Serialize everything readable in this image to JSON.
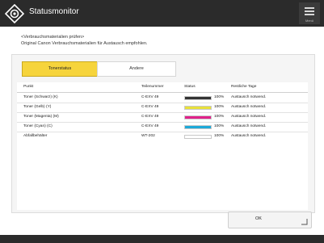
{
  "title_bar": {
    "app_title": "Statusmonitor",
    "menu_label": "Menü"
  },
  "message": {
    "line1": "<Verbrauchsmaterialien prüfen>",
    "line2": "Original Canon Verbrauchsmaterialien für Austausch empfohlen."
  },
  "tabs": [
    {
      "label": "Tonerstatus",
      "active": true
    },
    {
      "label": "Andere",
      "active": false
    }
  ],
  "table": {
    "headers": [
      "Punkt",
      "Teilenummer",
      "Status",
      "Restliche Tage"
    ],
    "rows": [
      {
        "item": "Toner (Schwarz) (K)",
        "part": "C-EXV 49",
        "level": "100%",
        "days": "Austausch notwend.",
        "color": "#333333"
      },
      {
        "item": "Toner (Gelb) (Y)",
        "part": "C-EXV 49",
        "level": "100%",
        "days": "Austausch notwend.",
        "color": "#e8e03a"
      },
      {
        "item": "Toner (Magenta) (M)",
        "part": "C-EXV 49",
        "level": "100%",
        "days": "Austausch notwend.",
        "color": "#e0218a"
      },
      {
        "item": "Toner (Cyan) (C)",
        "part": "C-EXV 49",
        "level": "100%",
        "days": "Austausch notwend.",
        "color": "#1ea9d8"
      },
      {
        "item": "Abfallbehälter",
        "part": "WT-202",
        "level": "100%",
        "days": "Austausch notwend.",
        "color": "#ffffff"
      }
    ]
  },
  "ok_button": {
    "label": "OK"
  },
  "colors": {
    "titlebar": "#2b2b2b",
    "active_tab": "#f6d43c"
  },
  "icons": [
    "status-monitor-icon",
    "menu-icon",
    "corner-arrow-icon"
  ]
}
